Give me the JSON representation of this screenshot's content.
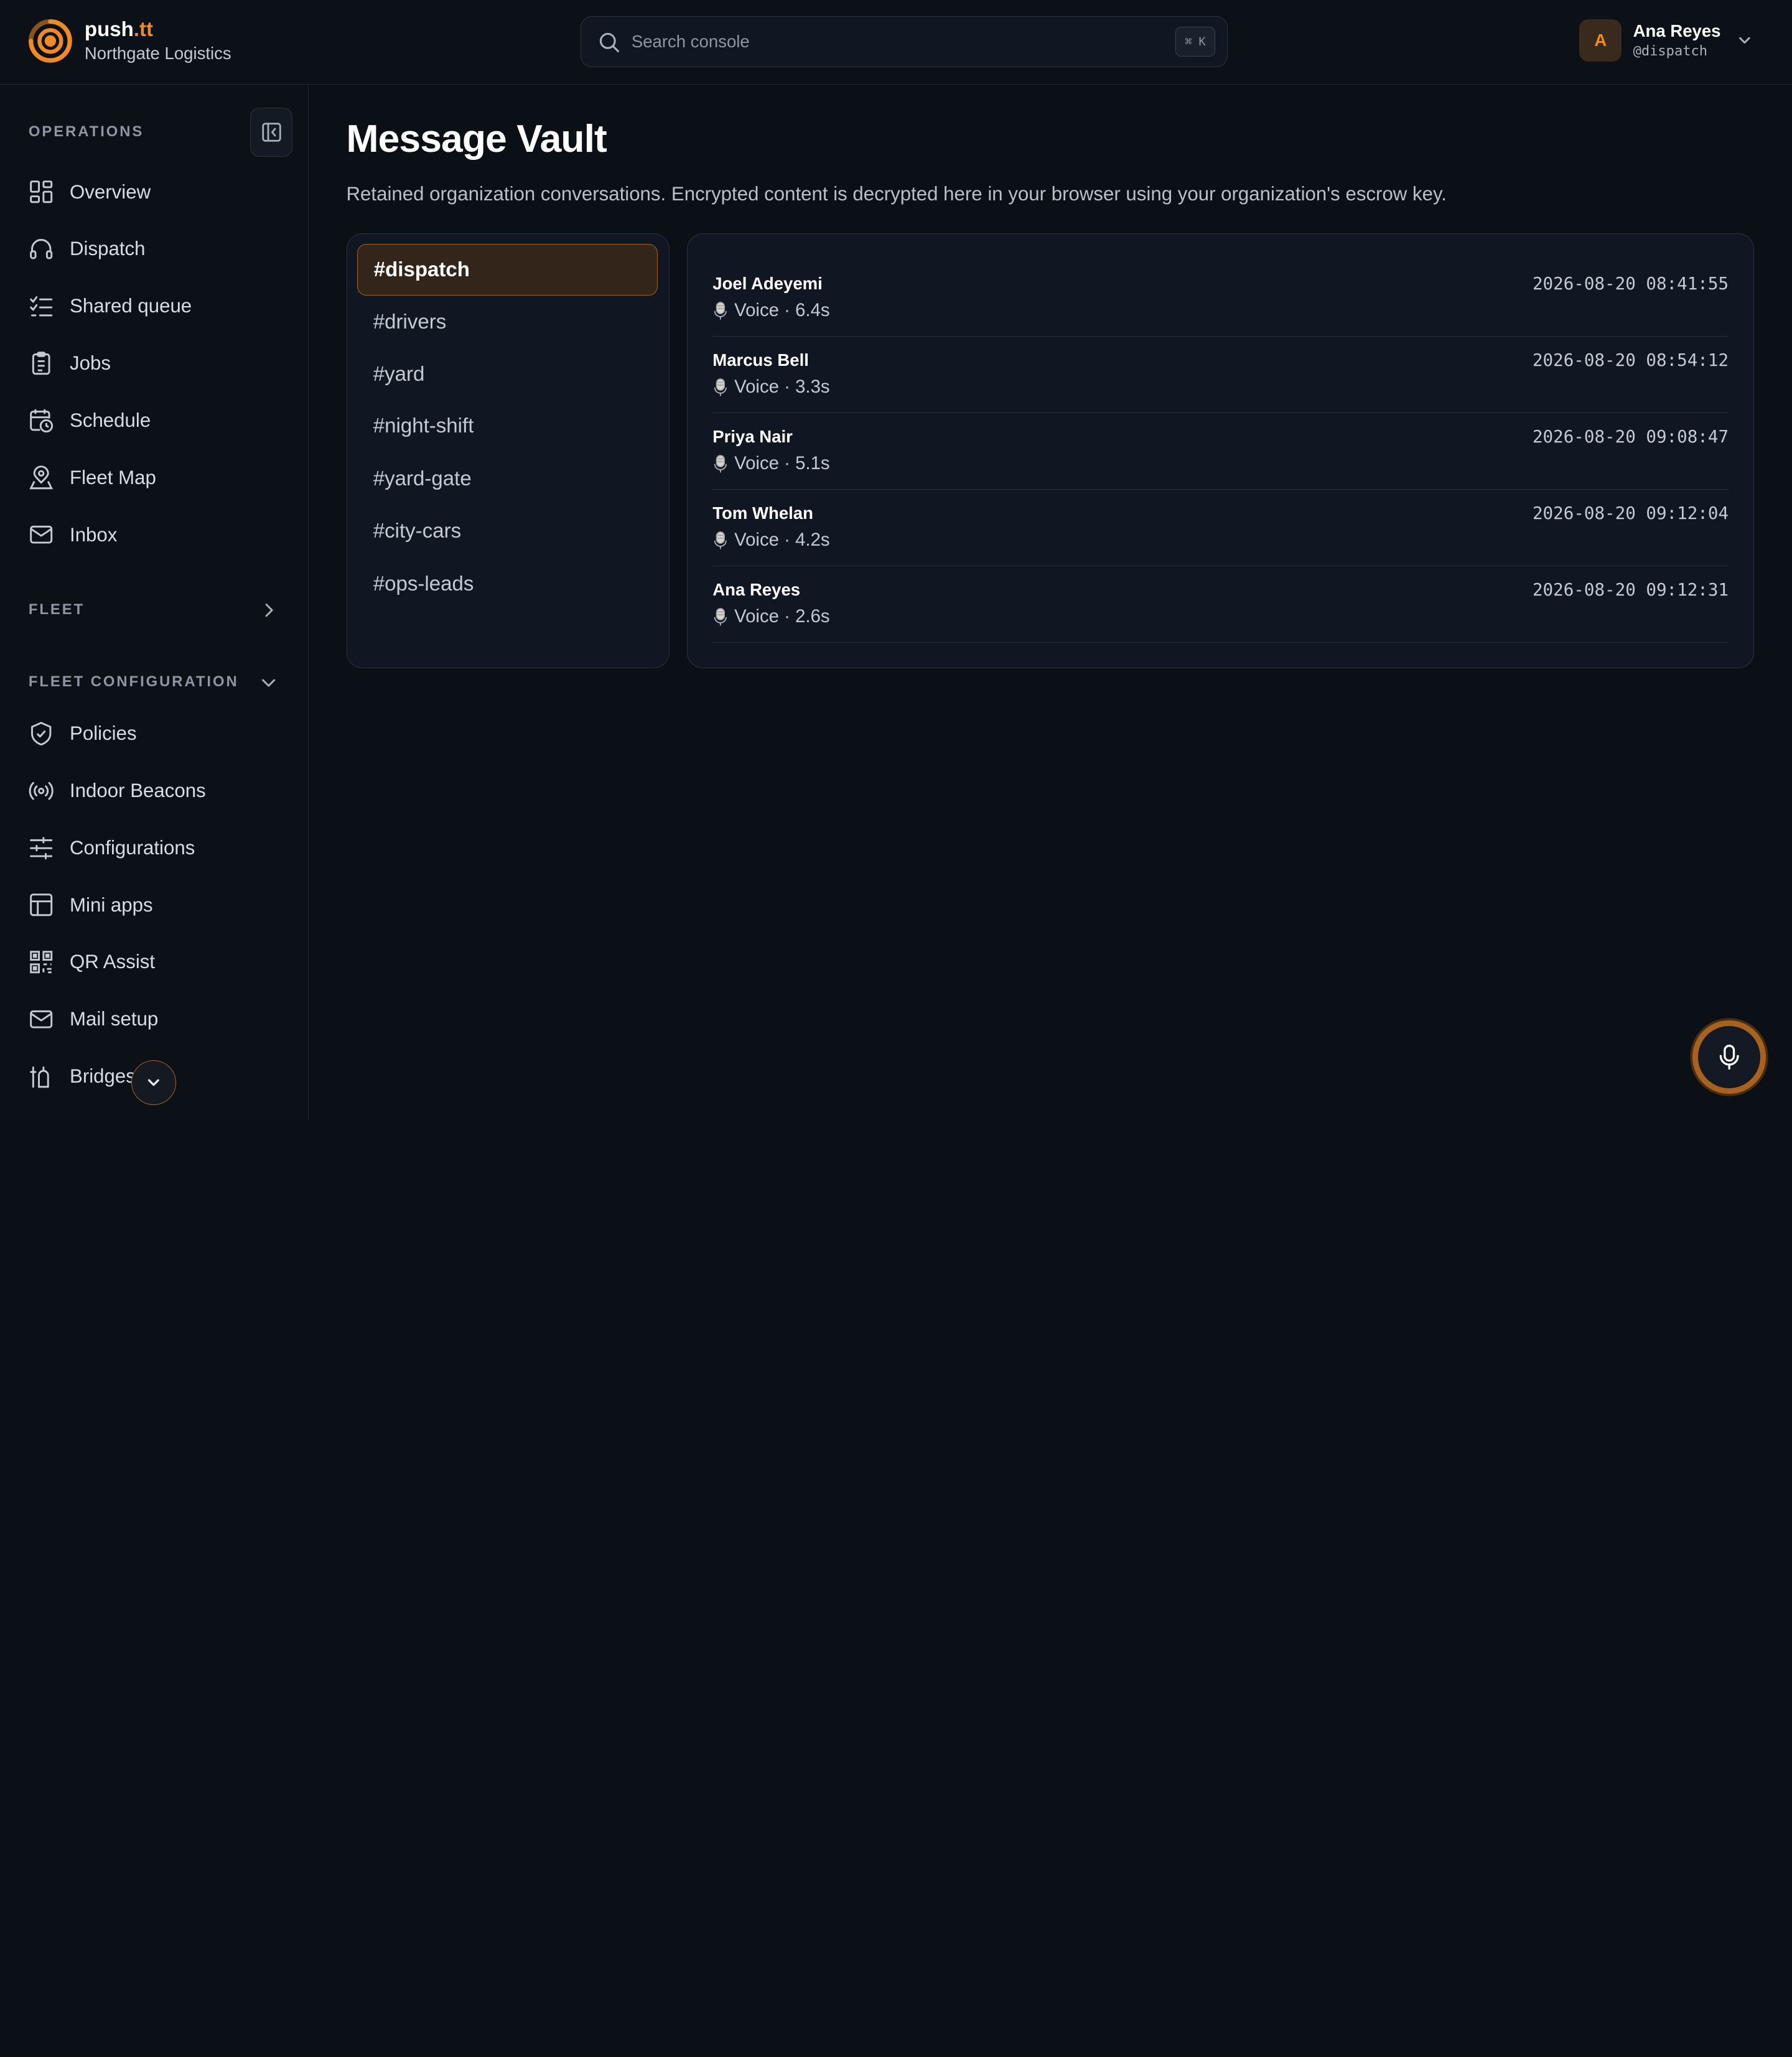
{
  "brand": {
    "name_main": "push",
    "name_tld": ".tt",
    "org": "Northgate Logistics"
  },
  "search": {
    "placeholder": "Search console",
    "shortcut": "⌘ K"
  },
  "user": {
    "initial": "A",
    "name": "Ana Reyes",
    "handle": "@dispatch"
  },
  "sidebar": {
    "operations_label": "OPERATIONS",
    "operations": [
      {
        "label": "Overview",
        "icon": "grid-icon"
      },
      {
        "label": "Dispatch",
        "icon": "headset-icon"
      },
      {
        "label": "Shared queue",
        "icon": "checklist-icon"
      },
      {
        "label": "Jobs",
        "icon": "clipboard-icon"
      },
      {
        "label": "Schedule",
        "icon": "calendar-clock-icon"
      },
      {
        "label": "Fleet Map",
        "icon": "map-pin-icon"
      },
      {
        "label": "Inbox",
        "icon": "mail-icon"
      }
    ],
    "fleet_label": "FLEET",
    "fleet_config_label": "FLEET CONFIGURATION",
    "fleet_config": [
      {
        "label": "Policies",
        "icon": "shield-check-icon"
      },
      {
        "label": "Indoor Beacons",
        "icon": "broadcast-icon"
      },
      {
        "label": "Configurations",
        "icon": "sliders-icon"
      },
      {
        "label": "Mini apps",
        "icon": "layout-icon"
      },
      {
        "label": "QR Assist",
        "icon": "qr-code-icon"
      },
      {
        "label": "Mail setup",
        "icon": "mail-icon"
      },
      {
        "label": "Bridges",
        "icon": "bridge-icon"
      }
    ]
  },
  "main": {
    "title": "Message Vault",
    "description": "Retained organization conversations. Encrypted content is decrypted here in your browser using your organization's escrow key.",
    "channels": [
      "#dispatch",
      "#drivers",
      "#yard",
      "#night-shift",
      "#yard-gate",
      "#city-cars",
      "#ops-leads"
    ],
    "active_channel": "#dispatch",
    "messages": [
      {
        "sender": "Joel Adeyemi",
        "content": "Voice · 6.4s",
        "time": "2026-08-20 08:41:55"
      },
      {
        "sender": "Marcus Bell",
        "content": "Voice · 3.3s",
        "time": "2026-08-20 08:54:12"
      },
      {
        "sender": "Priya Nair",
        "content": "Voice · 5.1s",
        "time": "2026-08-20 09:08:47"
      },
      {
        "sender": "Tom Whelan",
        "content": "Voice · 4.2s",
        "time": "2026-08-20 09:12:04"
      },
      {
        "sender": "Ana Reyes",
        "content": "Voice · 2.6s",
        "time": "2026-08-20 09:12:31"
      }
    ]
  },
  "colors": {
    "accent": "#f08a24",
    "background": "#0b0f16",
    "panel": "#111722",
    "border": "#2c3340"
  }
}
